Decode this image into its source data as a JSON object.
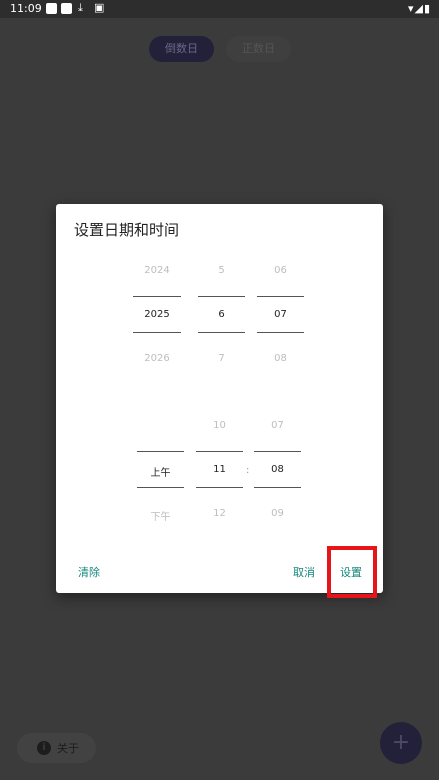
{
  "status_bar": {
    "time": "11:09",
    "left_icons": [
      "notification-square-icon",
      "notification-square-icon",
      "download-icon",
      "image-notification-icon"
    ],
    "right_icons": [
      "wifi-icon",
      "signal-icon",
      "battery-icon"
    ]
  },
  "background": {
    "tabs": [
      {
        "label": "倒数日",
        "active": true
      },
      {
        "label": "正数日",
        "active": false
      }
    ],
    "about_label": "关于",
    "fab_icon": "plus-icon"
  },
  "dialog": {
    "title": "设置日期和时间",
    "date_picker": {
      "year": {
        "prev": "2024",
        "selected": "2025",
        "next": "2026"
      },
      "month": {
        "prev": "5",
        "selected": "6",
        "next": "7"
      },
      "day": {
        "prev": "06",
        "selected": "07",
        "next": "08"
      }
    },
    "time_picker": {
      "ampm": {
        "prev": "",
        "selected": "上午",
        "next": "下午"
      },
      "hour": {
        "prev": "10",
        "selected": "11",
        "next": "12"
      },
      "separator": ":",
      "minute": {
        "prev": "07",
        "selected": "08",
        "next": "09"
      }
    },
    "buttons": {
      "clear": "清除",
      "cancel": "取消",
      "set": "设置"
    }
  },
  "colors": {
    "accent": "#14877b",
    "highlight": "#e5151a",
    "scrim_background": "#3b3b3b"
  }
}
